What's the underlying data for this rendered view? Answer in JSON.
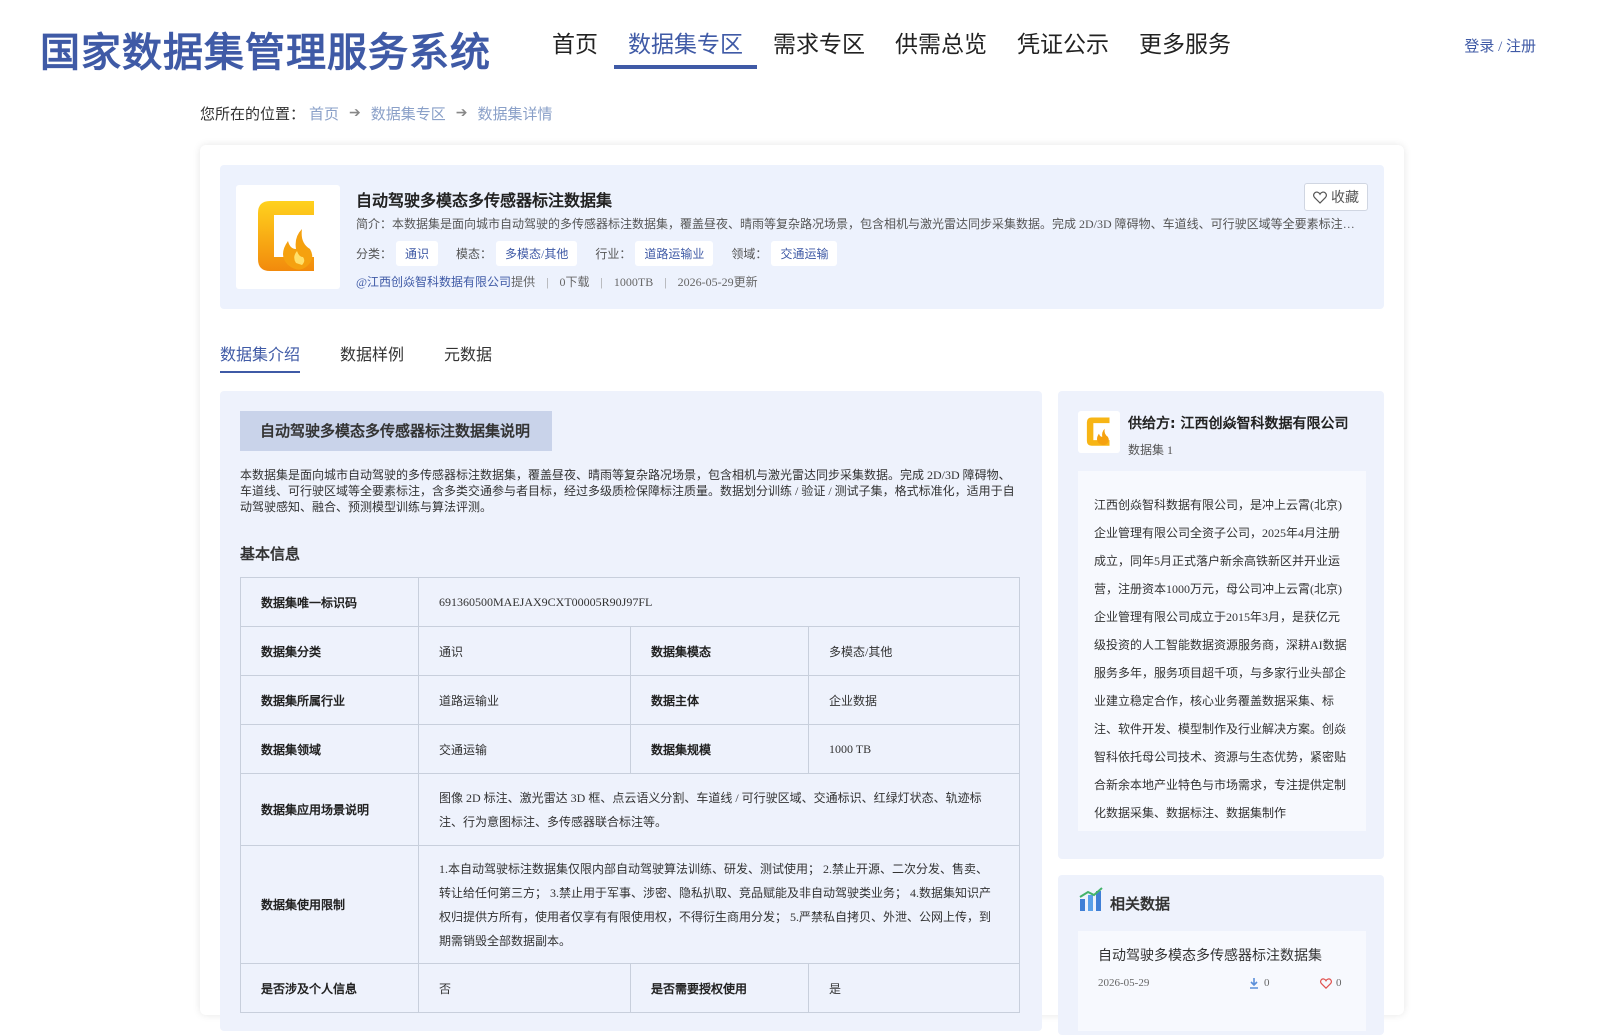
{
  "header": {
    "site_title": "国家数据集管理服务系统",
    "nav": [
      {
        "label": "首页",
        "active": false
      },
      {
        "label": "数据集专区",
        "active": true
      },
      {
        "label": "需求专区",
        "active": false
      },
      {
        "label": "供需总览",
        "active": false
      },
      {
        "label": "凭证公示",
        "active": false
      },
      {
        "label": "更多服务",
        "active": false
      }
    ],
    "login": "登录 / 注册"
  },
  "breadcrumb": {
    "prefix": "您所在的位置：",
    "items": [
      "首页",
      "数据集专区",
      "数据集详情"
    ]
  },
  "dataset": {
    "title": "自动驾驶多模态多传感器标注数据集",
    "fav_label": "收藏",
    "intro": "简介：本数据集是面向城市自动驾驶的多传感器标注数据集，覆盖昼夜、晴雨等复杂路况场景，包含相机与激光雷达同步采集数据。完成 2D/3D 障碍物、车道线、可行驶区域等全要素标注，含多类交通参与者目标，经过多级质检保障标注质量。",
    "tags": [
      {
        "key": "分类：",
        "value": "通识"
      },
      {
        "key": "模态：",
        "value": "多模态/其他"
      },
      {
        "key": "行业：",
        "value": "道路运输业"
      },
      {
        "key": "领域：",
        "value": "交通运输"
      }
    ],
    "provider": "@江西创焱智科数据有限公司",
    "provider_suffix": "提供",
    "downloads": "0下载",
    "size": "1000TB",
    "updated": "2026-05-29更新"
  },
  "tabs": [
    "数据集介绍",
    "数据样例",
    "元数据"
  ],
  "description": {
    "section_title": "自动驾驶多模态多传感器标注数据集说明",
    "text": "本数据集是面向城市自动驾驶的多传感器标注数据集，覆盖昼夜、晴雨等复杂路况场景，包含相机与激光雷达同步采集数据。完成 2D/3D 障碍物、车道线、可行驶区域等全要素标注，含多类交通参与者目标，经过多级质检保障标注质量。数据划分训练 / 验证 / 测试子集，格式标准化，适用于自动驾驶感知、融合、预测模型训练与算法评测。",
    "basic_title": "基本信息"
  },
  "info": {
    "id_key": "数据集唯一标识码",
    "id_val": "691360500MAEJAX9CXT00005R90J97FL",
    "cat_key": "数据集分类",
    "cat_val": "通识",
    "mod_key": "数据集模态",
    "mod_val": "多模态/其他",
    "ind_key": "数据集所属行业",
    "ind_val": "道路运输业",
    "sub_key": "数据主体",
    "sub_val": "企业数据",
    "dom_key": "数据集领域",
    "dom_val": "交通运输",
    "scale_key": "数据集规模",
    "scale_val": "1000 TB",
    "scene_key": "数据集应用场景说明",
    "scene_val": "图像 2D 标注、激光雷达 3D 框、点云语义分割、车道线 / 可行驶区域、交通标识、红绿灯状态、轨迹标注、行为意图标注、多传感器联合标注等。",
    "limit_key": "数据集使用限制",
    "limit_val": "1.本自动驾驶标注数据集仅限内部自动驾驶算法训练、研发、测试使用； 2.禁止开源、二次分发、售卖、转让给任何第三方； 3.禁止用于军事、涉密、隐私扒取、竞品赋能及非自动驾驶类业务； 4.数据集知识产权归提供方所有，使用者仅享有有限使用权，不得衍生商用分发； 5.严禁私自拷贝、外泄、公网上传，到期需销毁全部数据副本。",
    "pi_key": "是否涉及个人信息",
    "pi_val": "否",
    "auth_key": "是否需要授权使用",
    "auth_val": "是"
  },
  "supplier": {
    "name": "供给方: 江西创焱智科数据有限公司",
    "count": "数据集 1",
    "desc": "江西创焱智科数据有限公司，是冲上云霄(北京)企业管理有限公司全资子公司，2025年4月注册成立，同年5月正式落户新余高铁新区并开业运营，注册资本1000万元，母公司冲上云霄(北京)企业管理有限公司成立于2015年3月，是获亿元级投资的人工智能数据资源服务商，深耕AI数据服务多年，服务项目超千项，与多家行业头部企业建立稳定合作，核心业务覆盖数据采集、标注、软件开发、模型制作及行业解决方案。创焱智科依托母公司技术、资源与生态优势，紧密贴合新余本地产业特色与市场需求，专注提供定制化数据采集、数据标注、数据集制作"
  },
  "related": {
    "title": "相关数据",
    "items": [
      {
        "title": "自动驾驶多模态多传感器标注数据集",
        "date": "2026-05-29",
        "downloads": "0",
        "favs": "0"
      }
    ]
  },
  "colors": {
    "brand": "#3f5aa6",
    "panel": "#eef2fc",
    "tag_bg": "#ffffff"
  }
}
